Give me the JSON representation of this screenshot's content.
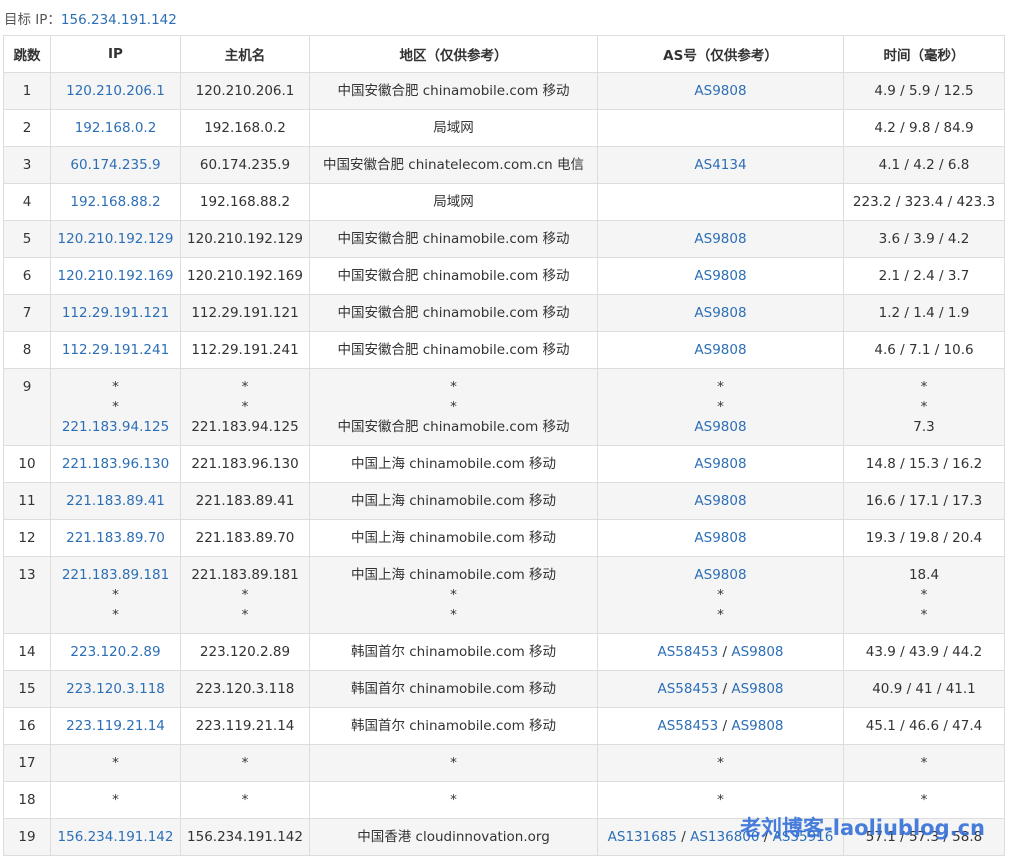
{
  "target": {
    "label": "目标 IP：",
    "ip": "156.234.191.142"
  },
  "columns": [
    "跳数",
    "IP",
    "主机名",
    "地区（仅供参考）",
    "AS号（仅供参考）",
    "时间（毫秒）"
  ],
  "rows": [
    {
      "hop": "1",
      "ip": [
        "120.210.206.1"
      ],
      "host": [
        "120.210.206.1"
      ],
      "region": [
        "中国安徽合肥 chinamobile.com 移动"
      ],
      "as": [
        [
          "AS9808"
        ]
      ],
      "time": [
        "4.9 / 5.9 / 12.5"
      ]
    },
    {
      "hop": "2",
      "ip": [
        "192.168.0.2"
      ],
      "host": [
        "192.168.0.2"
      ],
      "region": [
        "局域网"
      ],
      "as": [
        []
      ],
      "time": [
        "4.2 / 9.8 / 84.9"
      ]
    },
    {
      "hop": "3",
      "ip": [
        "60.174.235.9"
      ],
      "host": [
        "60.174.235.9"
      ],
      "region": [
        "中国安徽合肥 chinatelecom.com.cn 电信"
      ],
      "as": [
        [
          "AS4134"
        ]
      ],
      "time": [
        "4.1 / 4.2 / 6.8"
      ]
    },
    {
      "hop": "4",
      "ip": [
        "192.168.88.2"
      ],
      "host": [
        "192.168.88.2"
      ],
      "region": [
        "局域网"
      ],
      "as": [
        []
      ],
      "time": [
        "223.2 / 323.4 / 423.3"
      ]
    },
    {
      "hop": "5",
      "ip": [
        "120.210.192.129"
      ],
      "host": [
        "120.210.192.129"
      ],
      "region": [
        "中国安徽合肥 chinamobile.com 移动"
      ],
      "as": [
        [
          "AS9808"
        ]
      ],
      "time": [
        "3.6 / 3.9 / 4.2"
      ]
    },
    {
      "hop": "6",
      "ip": [
        "120.210.192.169"
      ],
      "host": [
        "120.210.192.169"
      ],
      "region": [
        "中国安徽合肥 chinamobile.com 移动"
      ],
      "as": [
        [
          "AS9808"
        ]
      ],
      "time": [
        "2.1 / 2.4 / 3.7"
      ]
    },
    {
      "hop": "7",
      "ip": [
        "112.29.191.121"
      ],
      "host": [
        "112.29.191.121"
      ],
      "region": [
        "中国安徽合肥 chinamobile.com 移动"
      ],
      "as": [
        [
          "AS9808"
        ]
      ],
      "time": [
        "1.2 / 1.4 / 1.9"
      ]
    },
    {
      "hop": "8",
      "ip": [
        "112.29.191.241"
      ],
      "host": [
        "112.29.191.241"
      ],
      "region": [
        "中国安徽合肥 chinamobile.com 移动"
      ],
      "as": [
        [
          "AS9808"
        ]
      ],
      "time": [
        "4.6 / 7.1 / 10.6"
      ]
    },
    {
      "hop": "9",
      "ip": [
        "*",
        "*",
        "221.183.94.125"
      ],
      "host": [
        "*",
        "*",
        "221.183.94.125"
      ],
      "region": [
        "*",
        "*",
        "中国安徽合肥 chinamobile.com 移动"
      ],
      "as": [
        [
          "*"
        ],
        [
          "*"
        ],
        [
          "AS9808"
        ]
      ],
      "time": [
        "*",
        "*",
        "7.3"
      ]
    },
    {
      "hop": "10",
      "ip": [
        "221.183.96.130"
      ],
      "host": [
        "221.183.96.130"
      ],
      "region": [
        "中国上海 chinamobile.com 移动"
      ],
      "as": [
        [
          "AS9808"
        ]
      ],
      "time": [
        "14.8 / 15.3 / 16.2"
      ]
    },
    {
      "hop": "11",
      "ip": [
        "221.183.89.41"
      ],
      "host": [
        "221.183.89.41"
      ],
      "region": [
        "中国上海 chinamobile.com 移动"
      ],
      "as": [
        [
          "AS9808"
        ]
      ],
      "time": [
        "16.6 / 17.1 / 17.3"
      ]
    },
    {
      "hop": "12",
      "ip": [
        "221.183.89.70"
      ],
      "host": [
        "221.183.89.70"
      ],
      "region": [
        "中国上海 chinamobile.com 移动"
      ],
      "as": [
        [
          "AS9808"
        ]
      ],
      "time": [
        "19.3 / 19.8 / 20.4"
      ]
    },
    {
      "hop": "13",
      "ip": [
        "221.183.89.181",
        "*",
        "*"
      ],
      "host": [
        "221.183.89.181",
        "*",
        "*"
      ],
      "region": [
        "中国上海 chinamobile.com 移动",
        "*",
        "*"
      ],
      "as": [
        [
          "AS9808"
        ],
        [
          "*"
        ],
        [
          "*"
        ]
      ],
      "time": [
        "18.4",
        "*",
        "*"
      ]
    },
    {
      "hop": "14",
      "ip": [
        "223.120.2.89"
      ],
      "host": [
        "223.120.2.89"
      ],
      "region": [
        "韩国首尔 chinamobile.com 移动"
      ],
      "as": [
        [
          "AS58453",
          "AS9808"
        ]
      ],
      "time": [
        "43.9 / 43.9 / 44.2"
      ]
    },
    {
      "hop": "15",
      "ip": [
        "223.120.3.118"
      ],
      "host": [
        "223.120.3.118"
      ],
      "region": [
        "韩国首尔 chinamobile.com 移动"
      ],
      "as": [
        [
          "AS58453",
          "AS9808"
        ]
      ],
      "time": [
        "40.9 / 41 / 41.1"
      ]
    },
    {
      "hop": "16",
      "ip": [
        "223.119.21.14"
      ],
      "host": [
        "223.119.21.14"
      ],
      "region": [
        "韩国首尔 chinamobile.com 移动"
      ],
      "as": [
        [
          "AS58453",
          "AS9808"
        ]
      ],
      "time": [
        "45.1 / 46.6 / 47.4"
      ]
    },
    {
      "hop": "17",
      "ip": [
        "*"
      ],
      "host": [
        "*"
      ],
      "region": [
        "*"
      ],
      "as": [
        [
          "*"
        ]
      ],
      "time": [
        "*"
      ]
    },
    {
      "hop": "18",
      "ip": [
        "*"
      ],
      "host": [
        "*"
      ],
      "region": [
        "*"
      ],
      "as": [
        [
          "*"
        ]
      ],
      "time": [
        "*"
      ]
    },
    {
      "hop": "19",
      "ip": [
        "156.234.191.142"
      ],
      "host": [
        "156.234.191.142"
      ],
      "region": [
        "中国香港 cloudinnovation.org"
      ],
      "as": [
        [
          "AS131685",
          "AS136800",
          "AS35916"
        ]
      ],
      "time": [
        "57.1 / 57.3 / 58.8"
      ]
    }
  ],
  "as_separator": " / ",
  "watermark": "老刘博客-laoliublog.cn"
}
